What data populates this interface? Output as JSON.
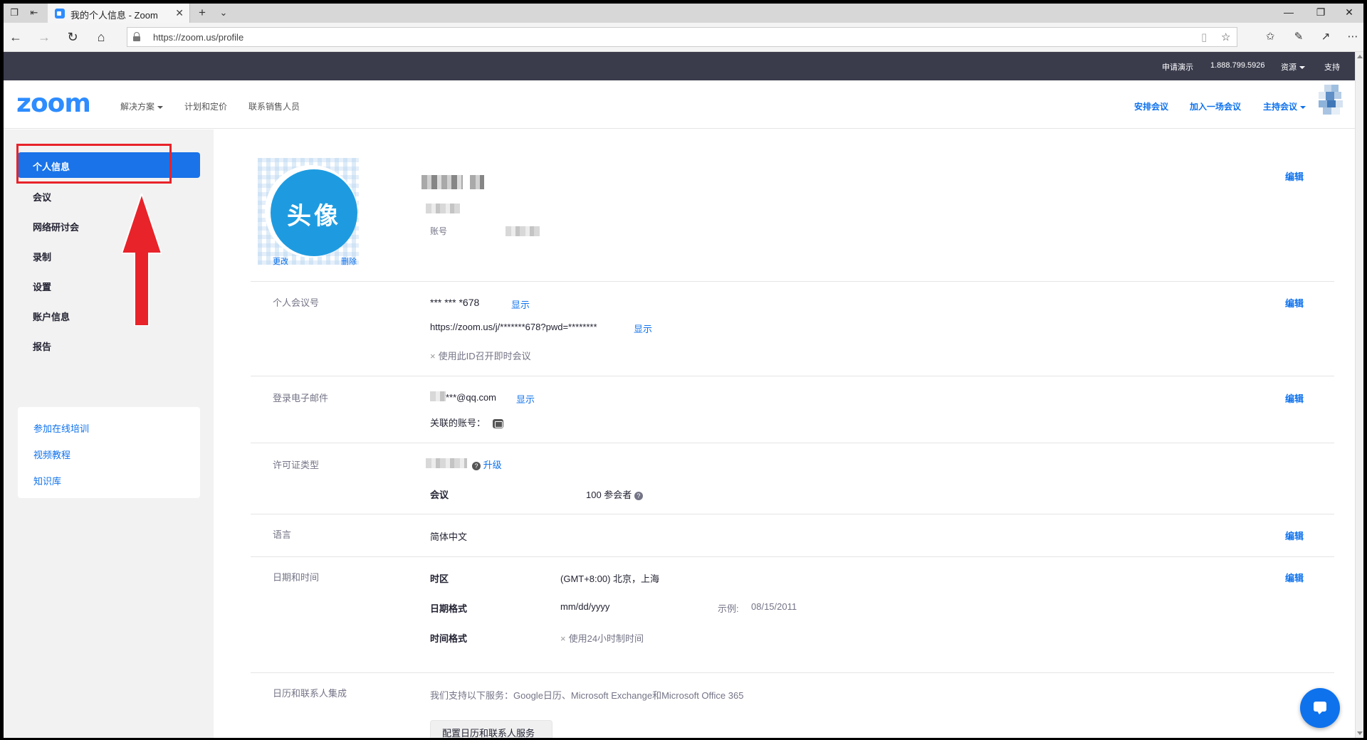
{
  "browser": {
    "tab_title": "我的个人信息 - Zoom",
    "url": "https://zoom.us/profile"
  },
  "topstrip": {
    "request_demo": "申请演示",
    "phone": "1.888.799.5926",
    "resources": "资源",
    "support": "支持"
  },
  "header": {
    "logo": "zoom",
    "nav": [
      "解决方案",
      "计划和定价",
      "联系销售人员"
    ],
    "schedule": "安排会议",
    "join": "加入一场会议",
    "host": "主持会议"
  },
  "sidebar": {
    "items": [
      "个人信息",
      "会议",
      "网络研讨会",
      "录制",
      "设置",
      "账户信息",
      "报告"
    ],
    "links": [
      "参加在线培训",
      "视频教程",
      "知识库"
    ]
  },
  "profile": {
    "avatar_text": "头像",
    "change": "更改",
    "delete": "删除",
    "account_label": "账号",
    "edit": "编辑",
    "pmi_label": "个人会议号",
    "pmi_value": "*** *** *678",
    "pmi_url": "https://zoom.us/j/*******678?pwd=********",
    "show": "显示",
    "pmi_instant": "使用此ID召开即时会议",
    "email_label": "登录电子邮件",
    "email_value": "***@qq.com",
    "linked_accounts": "关联的账号：",
    "license_label": "许可证类型",
    "upgrade": "升级",
    "meeting_label": "会议",
    "participants": "100 参会者",
    "language_label": "语言",
    "language_value": "简体中文",
    "datetime_label": "日期和时间",
    "timezone_label": "时区",
    "timezone_value": "(GMT+8:00) 北京，上海",
    "date_format_label": "日期格式",
    "date_format_value": "mm/dd/yyyy",
    "example_label": "示例:",
    "example_value": "08/15/2011",
    "time_format_label": "时间格式",
    "time_format_value": "使用24小时制时间",
    "calendar_label": "日历和联系人集成",
    "calendar_desc": "我们支持以下服务：Google日历、Microsoft Exchange和Microsoft Office 365",
    "calendar_button": "配置日历和联系人服务"
  },
  "colors": {
    "accent": "#0e72ed",
    "sidebar_active": "#1a73e8",
    "highlight": "#e8232a",
    "topstrip": "#3a3c4c"
  }
}
